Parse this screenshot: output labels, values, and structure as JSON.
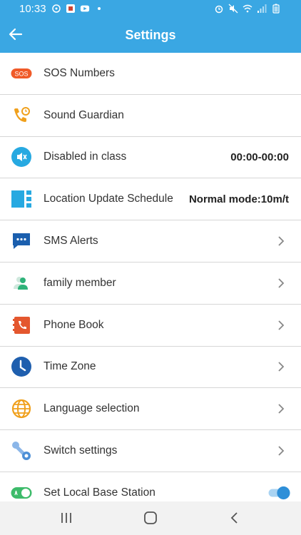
{
  "status_bar": {
    "time": "10:33",
    "left_icons": [
      "sync-icon",
      "app-icon",
      "youtube-icon",
      "dot-icon"
    ],
    "right_icons": [
      "alarm-icon",
      "mute-icon",
      "wifi-icon",
      "signal-icon",
      "battery-icon"
    ]
  },
  "header": {
    "title": "Settings",
    "back_icon": "arrow-left-icon",
    "color": "#3aa7e3"
  },
  "items": [
    {
      "label": "SOS Numbers",
      "icon": "sos-icon",
      "trailing": "none",
      "value": ""
    },
    {
      "label": "Sound Guardian",
      "icon": "phone-clock-icon",
      "trailing": "none",
      "value": ""
    },
    {
      "label": "Disabled in class",
      "icon": "speaker-mute-icon",
      "trailing": "value",
      "value": "00:00-00:00"
    },
    {
      "label": "Location Update Schedule",
      "icon": "schedule-icon",
      "trailing": "value",
      "value": "Normal mode:10m/t"
    },
    {
      "label": "SMS Alerts",
      "icon": "message-icon",
      "trailing": "chevron",
      "value": ""
    },
    {
      "label": "family member",
      "icon": "people-icon",
      "trailing": "chevron",
      "value": ""
    },
    {
      "label": "Phone Book",
      "icon": "phonebook-icon",
      "trailing": "chevron",
      "value": ""
    },
    {
      "label": "Time Zone",
      "icon": "clock-icon",
      "trailing": "chevron",
      "value": ""
    },
    {
      "label": "Language selection",
      "icon": "globe-icon",
      "trailing": "chevron",
      "value": ""
    },
    {
      "label": "Switch settings",
      "icon": "wrench-icon",
      "trailing": "chevron",
      "value": ""
    },
    {
      "label": "Set Local Base Station",
      "icon": "toggle-green-icon",
      "trailing": "toggle",
      "value": ""
    }
  ],
  "nav_bar": {
    "recent_icon": "recent-apps-icon",
    "home_icon": "home-icon",
    "back_icon": "nav-back-icon"
  },
  "colors": {
    "accent": "#3aa7e3",
    "sos": "#f05a28",
    "toggle_on": "#2e8fd8"
  }
}
